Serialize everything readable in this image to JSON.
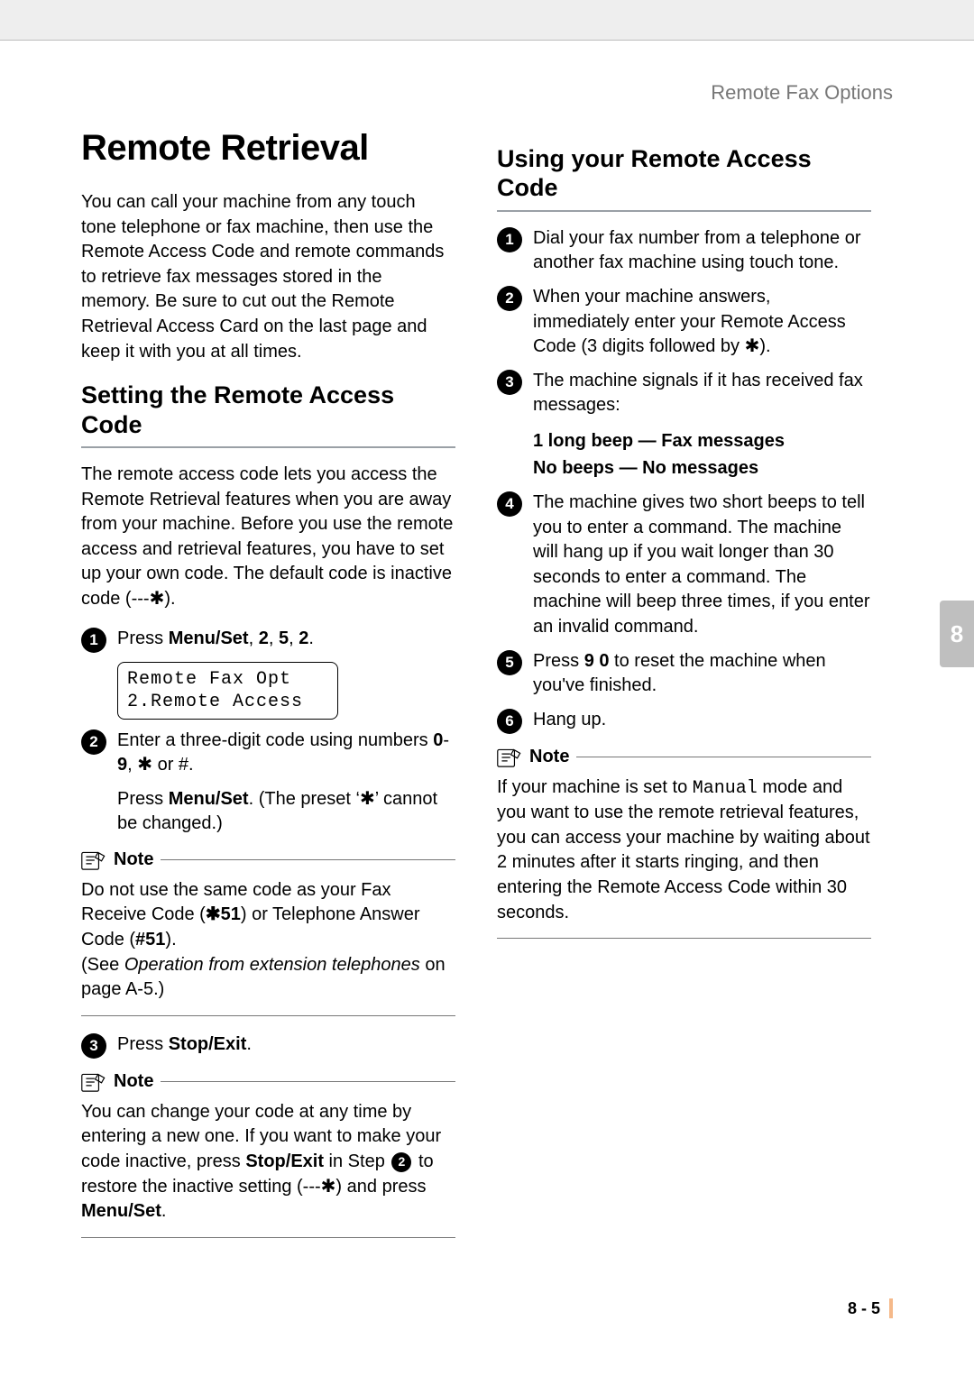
{
  "header": {
    "section": "Remote Fax Options"
  },
  "left": {
    "h1": "Remote Retrieval",
    "intro": "You can call your machine from any touch tone telephone or fax machine, then use the Remote Access Code and remote commands to retrieve fax messages stored in the memory. Be sure to cut out the Remote Retrieval Access Card on the last page and keep it with you at all times.",
    "h2": "Setting the Remote Access Code",
    "setting_intro_a": "The remote access code lets you access the Remote Retrieval features when you are away from your machine. Before you use the remote access and retrieval features, you have to set up your own code. The default code is inactive code (---",
    "setting_intro_b": ").",
    "step1_a": "Press ",
    "step1_b": "Menu/Set",
    "step1_c": ", ",
    "step1_d": "2",
    "step1_e": ", ",
    "step1_f": "5",
    "step1_g": ", ",
    "step1_h": "2",
    "step1_i": ".",
    "lcd": "Remote Fax Opt\n2.Remote Access",
    "step2_a": "Enter a three-digit code using numbers ",
    "step2_b": "0",
    "step2_c": "-",
    "step2_d": "9",
    "step2_e": ", ",
    "step2_f": " or #.",
    "step2_sub_a": "Press ",
    "step2_sub_b": "Menu/Set",
    "step2_sub_c": ". (The preset ‘",
    "step2_sub_d": "’ cannot be changed.)",
    "note1_label": "Note",
    "note1_a": "Do not use the same code as your Fax Receive Code (",
    "note1_b": "51",
    "note1_c": ") or Telephone Answer Code (",
    "note1_d": "#51",
    "note1_e": ").",
    "note1_f": "(See ",
    "note1_g": "Operation from extension telephones",
    "note1_h": " on page A-5.)",
    "step3_a": "Press ",
    "step3_b": "Stop/Exit",
    "step3_c": ".",
    "note2_label": "Note",
    "note2_a": "You can change your code at any time by entering a new one. If you want to make your code inactive, press ",
    "note2_b": "Stop/Exit",
    "note2_c": " in Step ",
    "note2_badge": "2",
    "note2_d": " to restore the inactive setting (---",
    "note2_e": ") and press ",
    "note2_f": "Menu/Set",
    "note2_g": "."
  },
  "right": {
    "h2": "Using your Remote Access Code",
    "step1": "Dial your fax number from a telephone or another fax machine using touch tone.",
    "step2_a": "When your machine answers, immediately enter your Remote Access Code (3 digits followed by ",
    "step2_b": ").",
    "step3": "The machine signals if it has received fax messages:",
    "sig1": "1 long beep — Fax messages",
    "sig2": "No beeps — No messages",
    "step4": "The machine gives two short beeps to tell you to enter a command. The machine will hang up if you wait longer than 30 seconds to enter a command. The machine will beep three times, if you enter an invalid command.",
    "step5_a": "Press ",
    "step5_b": "9 0",
    "step5_c": " to reset the machine when you've finished.",
    "step6": "Hang up.",
    "note_label": "Note",
    "note_a": "If your machine is set to ",
    "note_b": "Manual",
    "note_c": " mode and you want to use the remote retrieval features, you can access your machine by waiting about 2 minutes after it starts ringing, and then entering the Remote Access Code within 30 seconds."
  },
  "chapter": "8",
  "footer": "8 - 5",
  "glyphs": {
    "star": "✱"
  }
}
